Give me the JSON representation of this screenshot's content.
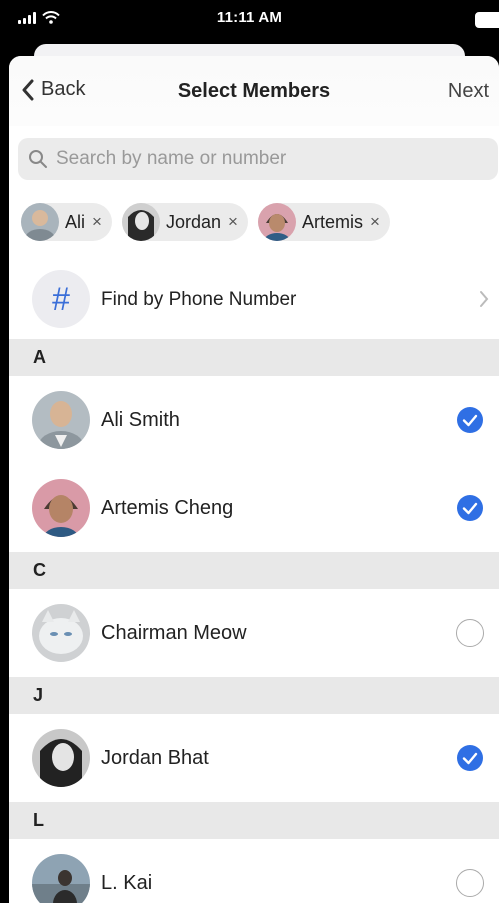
{
  "status_bar": {
    "time": "11:11 AM"
  },
  "nav": {
    "back_label": "Back",
    "title": "Select Members",
    "next_label": "Next"
  },
  "search": {
    "placeholder": "Search by name or number",
    "value": ""
  },
  "chips": [
    {
      "label": "Ali"
    },
    {
      "label": "Jordan"
    },
    {
      "label": "Artemis"
    }
  ],
  "chip_remove_glyph": "×",
  "find_phone": {
    "icon_glyph": "#",
    "label": "Find by Phone Number"
  },
  "sections": [
    {
      "letter": "A",
      "contacts": [
        {
          "name": "Ali Smith",
          "selected": true
        },
        {
          "name": "Artemis Cheng",
          "selected": true
        }
      ]
    },
    {
      "letter": "C",
      "contacts": [
        {
          "name": "Chairman Meow",
          "selected": false
        }
      ]
    },
    {
      "letter": "J",
      "contacts": [
        {
          "name": "Jordan Bhat",
          "selected": true
        }
      ]
    },
    {
      "letter": "L",
      "contacts": [
        {
          "name": "L. Kai",
          "selected": false
        }
      ]
    }
  ],
  "colors": {
    "accent": "#2f6fe4",
    "section_bg": "#e8e8e8",
    "search_bg": "#ebebeb"
  }
}
